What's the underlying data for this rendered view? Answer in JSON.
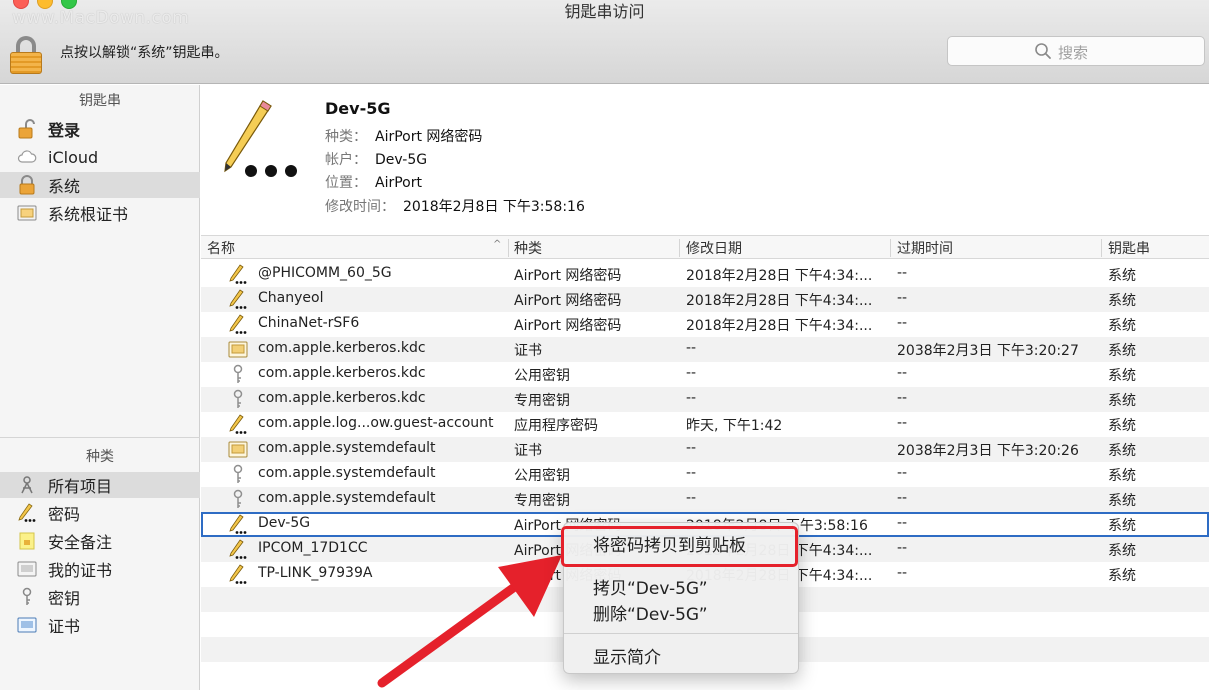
{
  "window": {
    "title": "钥匙串访问",
    "watermark": "www.MacDown.com",
    "unlock_text": "点按以解锁“系统”钥匙串。",
    "search_placeholder": "搜索"
  },
  "sidebar": {
    "keychains_header": "钥匙串",
    "keychains": [
      {
        "label": "登录",
        "icon": "lock-open-icon",
        "bold": true
      },
      {
        "label": "iCloud",
        "icon": "cloud-icon"
      },
      {
        "label": "系统",
        "icon": "lock-icon",
        "selected": true
      },
      {
        "label": "系统根证书",
        "icon": "certificate-folder-icon"
      }
    ],
    "categories_header": "种类",
    "categories": [
      {
        "label": "所有项目",
        "icon": "all-items-icon",
        "selected": true
      },
      {
        "label": "密码",
        "icon": "pencil-password-icon"
      },
      {
        "label": "安全备注",
        "icon": "secure-note-icon"
      },
      {
        "label": "我的证书",
        "icon": "my-certificate-icon"
      },
      {
        "label": "密钥",
        "icon": "key-icon"
      },
      {
        "label": "证书",
        "icon": "certificate-icon"
      }
    ]
  },
  "detail": {
    "name": "Dev-5G",
    "kind_label": "种类：",
    "kind_value": "AirPort 网络密码",
    "account_label": "帐户：",
    "account_value": "Dev-5G",
    "where_label": "位置：",
    "where_value": "AirPort",
    "modified_label": "修改时间：",
    "modified_value": "2018年2月8日 下午3:58:16"
  },
  "table": {
    "columns": [
      "名称",
      "种类",
      "修改日期",
      "过期时间",
      "钥匙串"
    ],
    "rows": [
      {
        "icon": "pencil-password-icon",
        "name": "@PHICOMM_60_5G",
        "kind": "AirPort 网络密码",
        "modified": "2018年2月28日 下午4:34:...",
        "expires": "--",
        "keychain": "系统"
      },
      {
        "icon": "pencil-password-icon",
        "name": "Chanyeol",
        "kind": "AirPort 网络密码",
        "modified": "2018年2月28日 下午4:34:...",
        "expires": "--",
        "keychain": "系统"
      },
      {
        "icon": "pencil-password-icon",
        "name": "ChinaNet-rSF6",
        "kind": "AirPort 网络密码",
        "modified": "2018年2月28日 下午4:34:...",
        "expires": "--",
        "keychain": "系统"
      },
      {
        "icon": "certificate-icon",
        "name": "com.apple.kerberos.kdc",
        "kind": "证书",
        "modified": "--",
        "expires": "2038年2月3日 下午3:20:27",
        "keychain": "系统"
      },
      {
        "icon": "key-icon",
        "name": "com.apple.kerberos.kdc",
        "kind": "公用密钥",
        "modified": "--",
        "expires": "--",
        "keychain": "系统"
      },
      {
        "icon": "key-icon",
        "name": "com.apple.kerberos.kdc",
        "kind": "专用密钥",
        "modified": "--",
        "expires": "--",
        "keychain": "系统"
      },
      {
        "icon": "pencil-password-icon",
        "name": "com.apple.log...ow.guest-account",
        "kind": "应用程序密码",
        "modified": "昨天, 下午1:42",
        "expires": "--",
        "keychain": "系统"
      },
      {
        "icon": "certificate-icon",
        "name": "com.apple.systemdefault",
        "kind": "证书",
        "modified": "--",
        "expires": "2038年2月3日 下午3:20:26",
        "keychain": "系统"
      },
      {
        "icon": "key-icon",
        "name": "com.apple.systemdefault",
        "kind": "公用密钥",
        "modified": "--",
        "expires": "--",
        "keychain": "系统"
      },
      {
        "icon": "key-icon",
        "name": "com.apple.systemdefault",
        "kind": "专用密钥",
        "modified": "--",
        "expires": "--",
        "keychain": "系统"
      },
      {
        "icon": "pencil-password-icon",
        "name": "Dev-5G",
        "kind": "AirPort 网络密码",
        "modified": "2018年2月8日 下午3:58:16",
        "expires": "--",
        "keychain": "系统",
        "selected": true
      },
      {
        "icon": "pencil-password-icon",
        "name": "IPCOM_17D1CC",
        "kind": "AirPort 网络密码",
        "modified": "2018年2月28日 下午4:34:...",
        "expires": "--",
        "keychain": "系统"
      },
      {
        "icon": "pencil-password-icon",
        "name": "TP-LINK_97939A",
        "kind": "AirPort 网络密码",
        "modified": "2018年2月28日 下午4:34:...",
        "expires": "--",
        "keychain": "系统"
      }
    ]
  },
  "context_menu": {
    "items": [
      "将密码拷贝到剪贴板",
      "拷贝“Dev-5G”",
      "删除“Dev-5G”",
      "显示简介"
    ],
    "highlighted_item": "将密码拷贝到剪贴板",
    "highlight_color": "#e5212b"
  },
  "colors": {
    "selection_outline": "#2e6cc4",
    "annotation_arrow": "#e5212b"
  }
}
